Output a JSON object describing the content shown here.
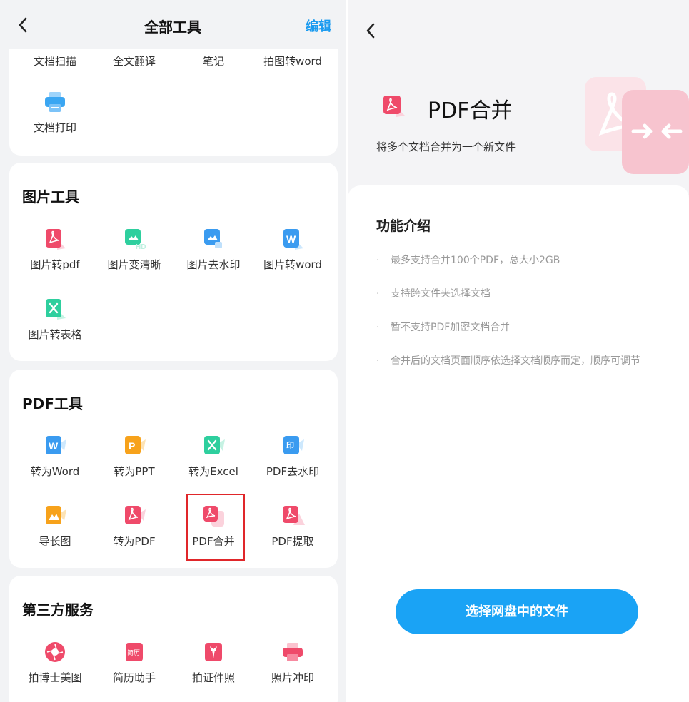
{
  "left": {
    "nav": {
      "title": "全部工具",
      "edit_label": "编辑"
    },
    "doc_tools": {
      "items": [
        {
          "label": "文档扫描"
        },
        {
          "label": "全文翻译"
        },
        {
          "label": "笔记"
        },
        {
          "label": "拍图转word"
        },
        {
          "label": "文档打印",
          "icon": "printer-icon"
        }
      ]
    },
    "image_tools": {
      "title": "图片工具",
      "items": [
        {
          "label": "图片转pdf",
          "icon": "pdf-icon"
        },
        {
          "label": "图片变清晰",
          "icon": "hd-image-icon"
        },
        {
          "label": "图片去水印",
          "icon": "watermark-image-icon"
        },
        {
          "label": "图片转word",
          "icon": "word-icon"
        },
        {
          "label": "图片转表格",
          "icon": "excel-icon"
        }
      ]
    },
    "pdf_tools": {
      "title": "PDF工具",
      "items": [
        {
          "label": "转为Word",
          "icon": "word-icon"
        },
        {
          "label": "转为PPT",
          "icon": "ppt-icon"
        },
        {
          "label": "转为Excel",
          "icon": "excel-icon"
        },
        {
          "label": "PDF去水印",
          "icon": "watermark-icon"
        },
        {
          "label": "导长图",
          "icon": "long-image-icon"
        },
        {
          "label": "转为PDF",
          "icon": "pdf-icon"
        },
        {
          "label": "PDF合并",
          "icon": "pdf-merge-icon"
        },
        {
          "label": "PDF提取",
          "icon": "pdf-extract-icon"
        }
      ]
    },
    "third_party": {
      "title": "第三方服务",
      "items": [
        {
          "label": "拍博士美图",
          "icon": "camera-icon"
        },
        {
          "label": "简历助手",
          "icon": "resume-icon",
          "icon_text": "简历"
        },
        {
          "label": "拍证件照",
          "icon": "id-photo-icon"
        },
        {
          "label": "照片冲印",
          "icon": "photo-print-icon"
        }
      ]
    }
  },
  "right": {
    "title": "PDF合并",
    "subtitle": "将多个文档合并为一个新文件",
    "features_title": "功能介绍",
    "features": [
      "最多支持合并100个PDF，总大小2GB",
      "支持跨文件夹选择文档",
      "暂不支持PDF加密文档合并",
      "合并后的文档页面顺序依选择文档顺序而定，顺序可调节"
    ],
    "bullet": "·",
    "cta_label": "选择网盘中的文件"
  },
  "colors": {
    "accent": "#1aa3f5",
    "pdf_red": "#ef4a6a",
    "word_blue": "#3a9bf0",
    "excel_green": "#2ecf9e",
    "ppt_orange": "#f7a21b",
    "highlight": "#e0262a"
  }
}
